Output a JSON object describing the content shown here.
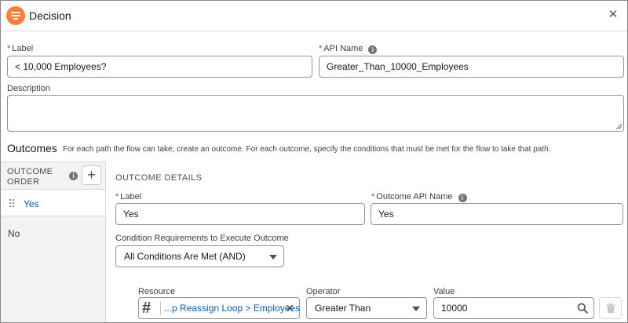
{
  "header": {
    "title": "Decision",
    "logo_icon": "decision-icon",
    "close_icon": "close-icon"
  },
  "label_field": {
    "label": "Label",
    "required": true,
    "value": "< 10,000 Employees?"
  },
  "api_name_field": {
    "label": "API Name",
    "required": true,
    "value": "Greater_Than_10000_Employees"
  },
  "description_field": {
    "label": "Description",
    "value": ""
  },
  "outcomes": {
    "title": "Outcomes",
    "description": "For each path the flow can take, create an outcome. For each outcome, specify the conditions that must be met for the flow to take that path."
  },
  "outcome_order": {
    "heading_line1": "OUTCOME",
    "heading_line2": "ORDER",
    "add_label": "+",
    "items": [
      {
        "label": "Yes",
        "selected": true
      },
      {
        "label": "No",
        "selected": false
      }
    ]
  },
  "outcome_details": {
    "heading": "OUTCOME DETAILS",
    "label_field": {
      "label": "Label",
      "required": true,
      "value": "Yes"
    },
    "api_name_field": {
      "label": "Outcome API Name",
      "required": true,
      "value": "Yes"
    },
    "condition_requirements": {
      "label": "Condition Requirements to Execute Outcome",
      "selected": "All Conditions Are Met (AND)"
    },
    "condition": {
      "resource_label": "Resource",
      "resource_value": "...p Reassign Loop > Employees",
      "operator_label": "Operator",
      "operator_value": "Greater Than",
      "value_label": "Value",
      "value_value": "10000"
    }
  },
  "colors": {
    "accent": "#0b5cab",
    "logo": "#ff7e3a",
    "required": "#c23934",
    "border": "#969492",
    "panel_bg": "#f3f3f3"
  }
}
